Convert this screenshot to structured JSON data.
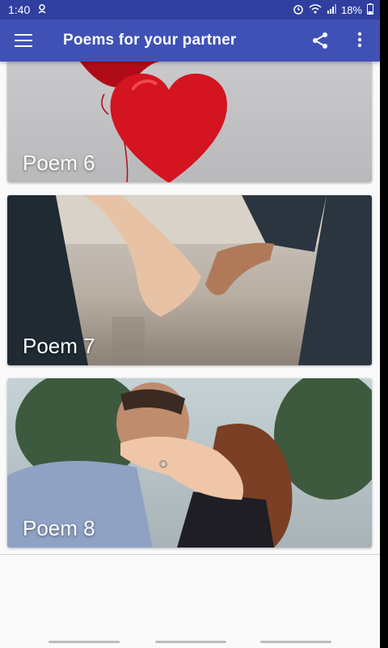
{
  "status": {
    "time": "1:40",
    "battery": "18%"
  },
  "app_bar": {
    "title": "Poems for your partner",
    "icons": [
      "menu-icon",
      "share-icon",
      "more-vert-icon"
    ]
  },
  "cards": [
    {
      "label": "Poem 6",
      "image": "red heart balloons"
    },
    {
      "label": "Poem 7",
      "image": "couple holding pinky fingers"
    },
    {
      "label": "Poem 8",
      "image": "couple with engagement ring"
    }
  ],
  "colors": {
    "status_bar": "#303f9f",
    "app_bar": "#3f51b5",
    "background": "#fafafa"
  }
}
